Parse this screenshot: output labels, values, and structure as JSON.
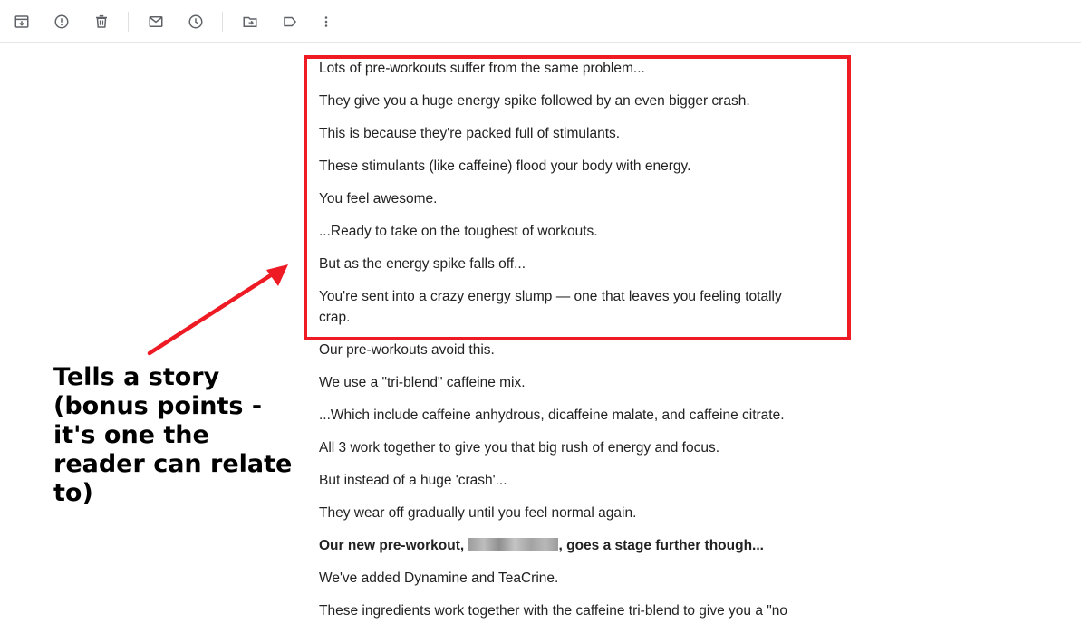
{
  "toolbar": {
    "buttons": [
      {
        "icon": "archive-icon"
      },
      {
        "icon": "report-spam-icon"
      },
      {
        "icon": "delete-icon"
      },
      {
        "icon": "mark-unread-icon"
      },
      {
        "icon": "snooze-icon"
      },
      {
        "icon": "move-to-icon"
      },
      {
        "icon": "label-icon"
      },
      {
        "icon": "more-options-icon"
      }
    ]
  },
  "email": {
    "paragraphs": [
      "Lots of pre-workouts suffer from the same problem...",
      "They give you a huge energy spike followed by an even bigger crash.",
      "This is because they're packed full of stimulants.",
      "These stimulants (like caffeine) flood your body with energy.",
      "You feel awesome.",
      "...Ready to take on the toughest of workouts.",
      "But as the energy spike falls off...",
      "You're sent into a crazy energy slump — one that leaves you feeling totally crap.",
      "Our pre-workouts avoid this.",
      "We use a \"tri-blend\" caffeine mix.",
      "...Which include caffeine anhydrous, dicaffeine malate, and caffeine citrate.",
      "All 3 work together to give you that big rush of energy and focus.",
      "But instead of a huge 'crash'...",
      "They wear off gradually until you feel normal again."
    ],
    "bold_line_before": "Our new pre-workout, ",
    "bold_line_after": ", goes a stage further though...",
    "paragraphs_after": [
      "We've added Dynamine and TeaCrine.",
      "These ingredients work together with the caffeine tri-blend to give you a \"no"
    ]
  },
  "annotation": {
    "text": "Tells a story (bonus points - it's one the reader can relate to)"
  },
  "colors": {
    "highlight": "#ee1b24",
    "arrow": "#ee1b24",
    "icon": "#5f6368"
  }
}
